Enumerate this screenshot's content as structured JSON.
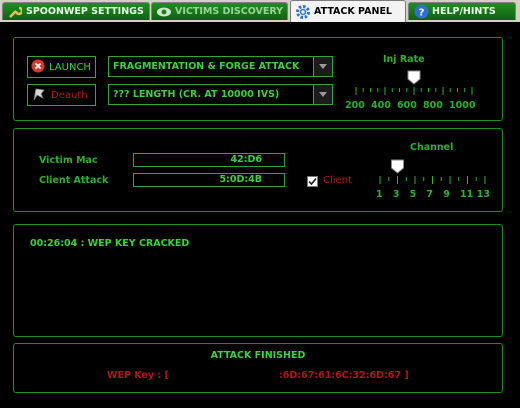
{
  "tabs": [
    {
      "label": "SPOONWEP SETTINGS",
      "icon": "wrench-icon"
    },
    {
      "label": "VICTIMS DISCOVERY",
      "icon": "eye-icon"
    },
    {
      "label": "ATTACK PANEL",
      "icon": "gear-icon"
    },
    {
      "label": "HELP/HINTS",
      "icon": "help-icon"
    }
  ],
  "attack": {
    "launch_label": "LAUNCH",
    "deauth_label": "Deauth",
    "attack_type": "FRAGMENTATION & FORGE ATTACK",
    "length_option": "??? LENGTH (CR. AT 10000 IVS)",
    "inj_rate_title": "Inj Rate",
    "inj_rate_ticks": [
      "200",
      "400",
      "600",
      "800",
      "1000"
    ],
    "inj_rate_value": 600
  },
  "target": {
    "victim_mac_label": "Victim Mac",
    "victim_mac_value": "42:D6",
    "client_attack_label": "Client Attack",
    "client_attack_value": "5:0D:4B",
    "client_checkbox_label": "Client",
    "client_checked": true,
    "channel_title": "Channel",
    "channel_ticks": [
      "1",
      "3",
      "5",
      "7",
      "9",
      "11",
      "13"
    ],
    "channel_value": 3
  },
  "log": {
    "line": "00:26:04 : WEP KEY CRACKED"
  },
  "status": {
    "title": "ATTACK FINISHED",
    "wep_key_label": "WEP Key : [",
    "wep_key_value": ":6D:67:61:6C:32:6D:67 ]"
  },
  "colors": {
    "accent_green": "#2db12d",
    "alert_red": "#b41414",
    "background": "#000000"
  }
}
